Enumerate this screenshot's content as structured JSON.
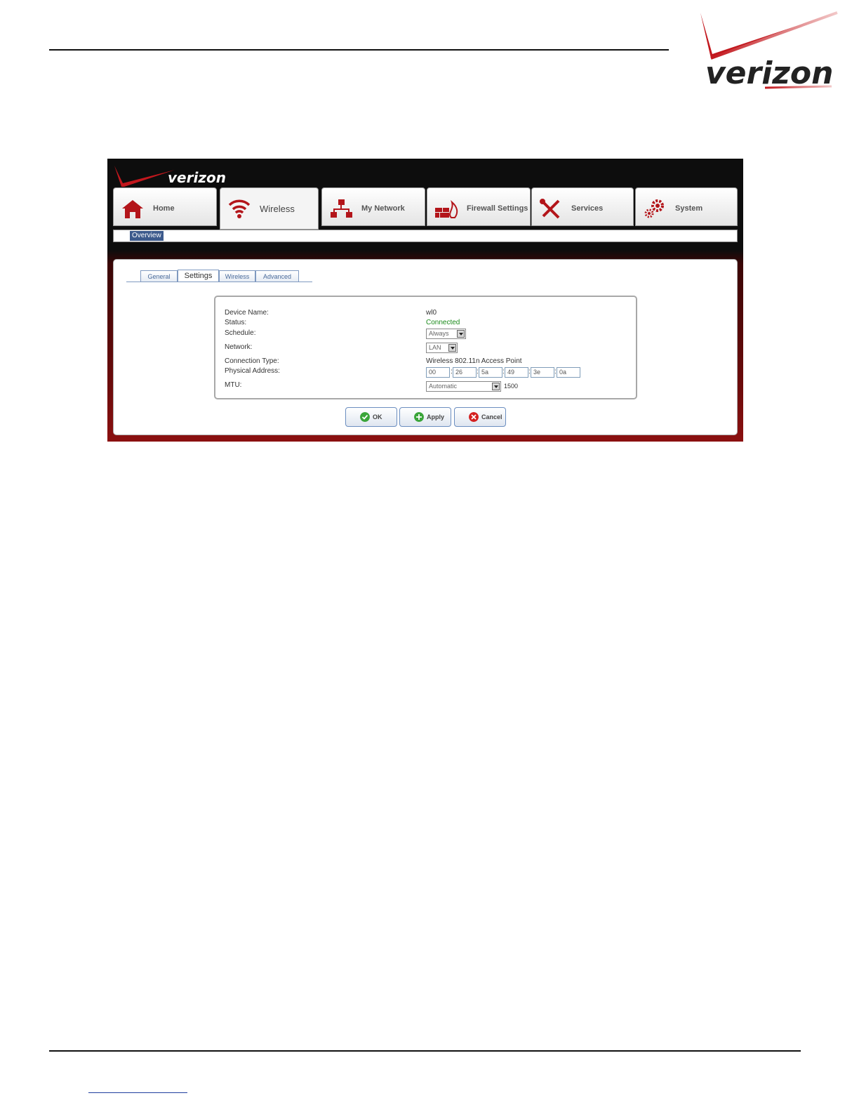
{
  "page_logo_text": "verizon",
  "app": {
    "logo_text": "verizon",
    "nav_tabs": [
      {
        "label": "Home",
        "icon": "home-icon"
      },
      {
        "label": "Wireless",
        "icon": "wifi-icon"
      },
      {
        "label": "My Network",
        "icon": "network-icon"
      },
      {
        "label": "Firewall Settings",
        "icon": "firewall-icon"
      },
      {
        "label": "Services",
        "icon": "tools-icon"
      },
      {
        "label": "System",
        "icon": "gears-icon"
      }
    ],
    "active_nav": "Wireless",
    "subnav": {
      "overview": "Overview"
    },
    "sub_tabs": [
      "General",
      "Settings",
      "Wireless",
      "Advanced"
    ],
    "active_sub_tab": "Settings",
    "form": {
      "device_name_label": "Device Name:",
      "device_name_value": "wl0",
      "status_label": "Status:",
      "status_value": "Connected",
      "schedule_label": "Schedule:",
      "schedule_value": "Always",
      "network_label": "Network:",
      "network_value": "LAN",
      "connection_type_label": "Connection Type:",
      "connection_type_value": "Wireless 802.11n Access Point",
      "physical_address_label": "Physical Address:",
      "mac": [
        "00",
        "26",
        "5a",
        "49",
        "3e",
        "0a"
      ],
      "mtu_label": "MTU:",
      "mtu_mode": "Automatic",
      "mtu_value": "1500"
    },
    "buttons": {
      "ok": "OK",
      "apply": "Apply",
      "cancel": "Cancel"
    },
    "colors": {
      "brand_red": "#cd1111",
      "status_green": "#1a8a1a",
      "tab_blue": "#3c5a8c"
    }
  }
}
